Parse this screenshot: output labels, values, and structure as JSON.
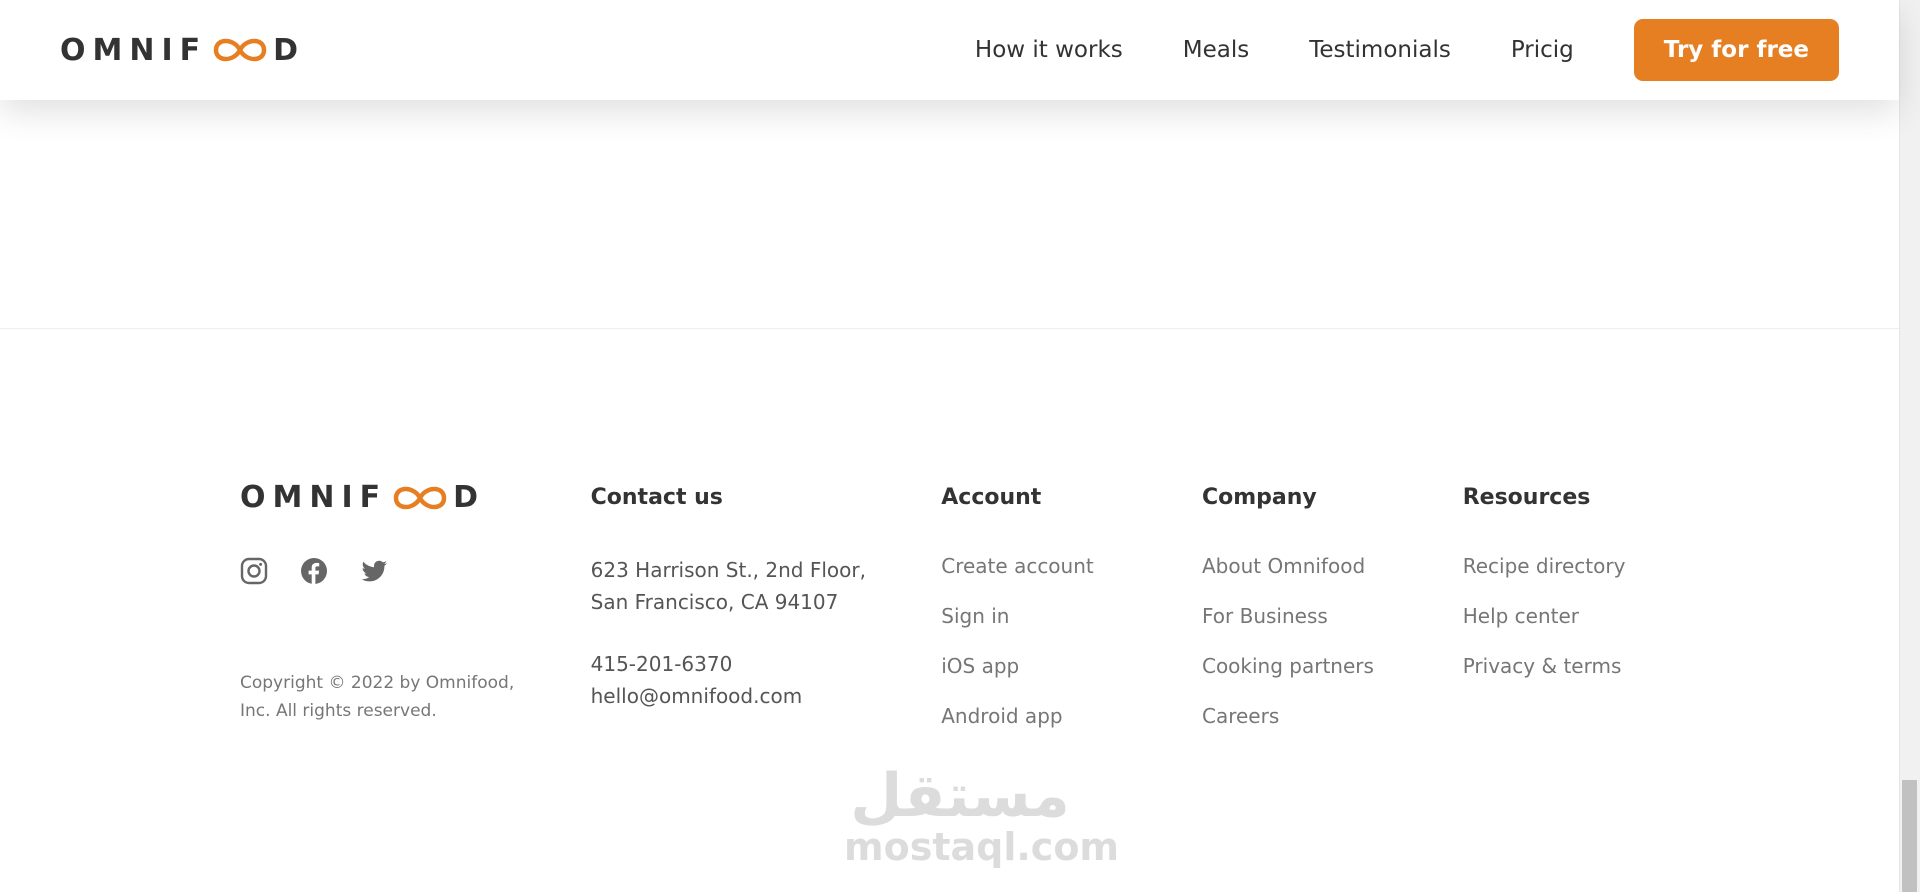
{
  "header": {
    "logo_prefix": "OMNIF",
    "logo_suffix": "D",
    "nav": [
      "How it works",
      "Meals",
      "Testimonials",
      "Pricig"
    ],
    "cta_label": "Try for free"
  },
  "colors": {
    "accent": "#e67e22",
    "text": "#333333",
    "muted": "#767676"
  },
  "footer": {
    "logo_prefix": "OMNIF",
    "logo_suffix": "D",
    "social_icons": [
      "instagram-icon",
      "facebook-icon",
      "twitter-icon"
    ],
    "copyright_line1": "Copyright © 2022 by Omnifood,",
    "copyright_line2": "Inc. All rights reserved.",
    "contact": {
      "title": "Contact us",
      "address_line1": "623 Harrison St., 2nd Floor,",
      "address_line2": "San Francisco, CA 94107",
      "phone": "415-201-6370",
      "email": "hello@omnifood.com"
    },
    "account": {
      "title": "Account",
      "links": [
        "Create account",
        "Sign in",
        "iOS app",
        "Android app"
      ]
    },
    "company": {
      "title": "Company",
      "links": [
        "About Omnifood",
        "For Business",
        "Cooking partners",
        "Careers"
      ]
    },
    "resources": {
      "title": "Resources",
      "links": [
        "Recipe directory",
        "Help center",
        "Privacy & terms"
      ]
    }
  },
  "watermark": {
    "arabic": "مستقل",
    "latin": "mostaql.com"
  }
}
